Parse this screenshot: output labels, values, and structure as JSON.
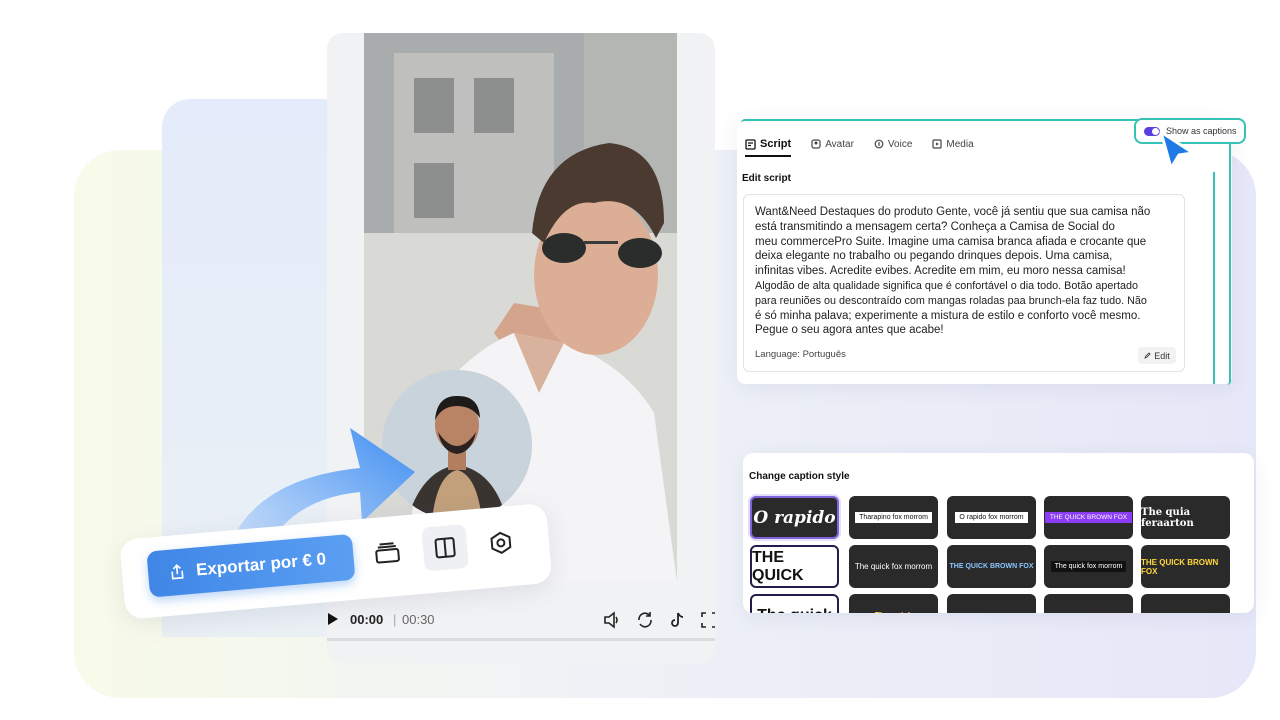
{
  "export_toolbar": {
    "export_label": "Exportar por € 0"
  },
  "player": {
    "current_time": "00:00",
    "separator": "|",
    "total_time": "00:30"
  },
  "script_panel": {
    "tabs": [
      {
        "label": "Script",
        "icon": "script-icon",
        "active": true
      },
      {
        "label": "Avatar",
        "icon": "avatar-icon",
        "active": false
      },
      {
        "label": "Voice",
        "icon": "voice-icon",
        "active": false
      },
      {
        "label": "Media",
        "icon": "media-icon",
        "active": false
      }
    ],
    "edit_script_label": "Edit script",
    "script_lines": [
      "Want&Need Destaques do produto Gente, você já sentiu que sua camisa não",
      "está transmitindo a mensagem certa? Conheça a Camisa de Social do",
      "meu commercePro Suite. Imagine uma camisa branca afiada e crocante que",
      "deixa elegante no trabalho ou pegando drinques depois. Uma camisa,",
      "infinitas vibes. Acredite evibes. Acredite em mim, eu moro nessa camisa!",
      "Algodão de alta qualidade significa que é confortável o dia todo. Botão apertado",
      "para reuniões ou descontraído com mangas roladas paa brunch-ela faz tudo. Não",
      "é só minha palava; experimente a mistura de estilo e conforto você mesmo.",
      "Pegue o seu agora antes que acabe!"
    ],
    "language_label": "Language:",
    "language_value": "Português",
    "edit_label": "Edit",
    "show_captions_label": "Show as captions"
  },
  "caption_panel": {
    "title": "Change caption style",
    "styles": [
      {
        "label": "O rapido",
        "kind": "t-big",
        "tile": "selected"
      },
      {
        "label": "Tharapino fox morrom",
        "kind": "t-boxed",
        "tile": ""
      },
      {
        "label": "O rapido fox morrom",
        "kind": "t-boxed",
        "tile": ""
      },
      {
        "label": "THE QUICK BROWN FOX",
        "kind": "t-purple",
        "tile": ""
      },
      {
        "label": "The quia feraarton",
        "kind": "t-heavy",
        "tile": ""
      },
      {
        "label": "THE QUICK",
        "kind": "t-quick",
        "tile": "light"
      },
      {
        "label": "The quick fox morrom",
        "kind": "t-small",
        "tile": ""
      },
      {
        "label": "THE QUICK BROWN FOX",
        "kind": "t-blue",
        "tile": ""
      },
      {
        "label": "The quick fox morrom",
        "kind": "t-black",
        "tile": ""
      },
      {
        "label": "THE QUICK BROWN FOX",
        "kind": "t-yellow",
        "tile": ""
      },
      {
        "label": "The quick",
        "kind": "t-quick",
        "tile": "light"
      },
      {
        "label": "The quick",
        "kind": "t-yellow",
        "tile": ""
      },
      {
        "label": "",
        "kind": "t-small",
        "tile": ""
      },
      {
        "label": "",
        "kind": "t-small",
        "tile": ""
      },
      {
        "label": "",
        "kind": "t-small",
        "tile": ""
      }
    ]
  },
  "colors": {
    "accent_teal": "#36c2b4",
    "export_blue": "#3f86e6",
    "toggle_purple": "#5a3ee0",
    "cursor_blue": "#1e7be6"
  }
}
